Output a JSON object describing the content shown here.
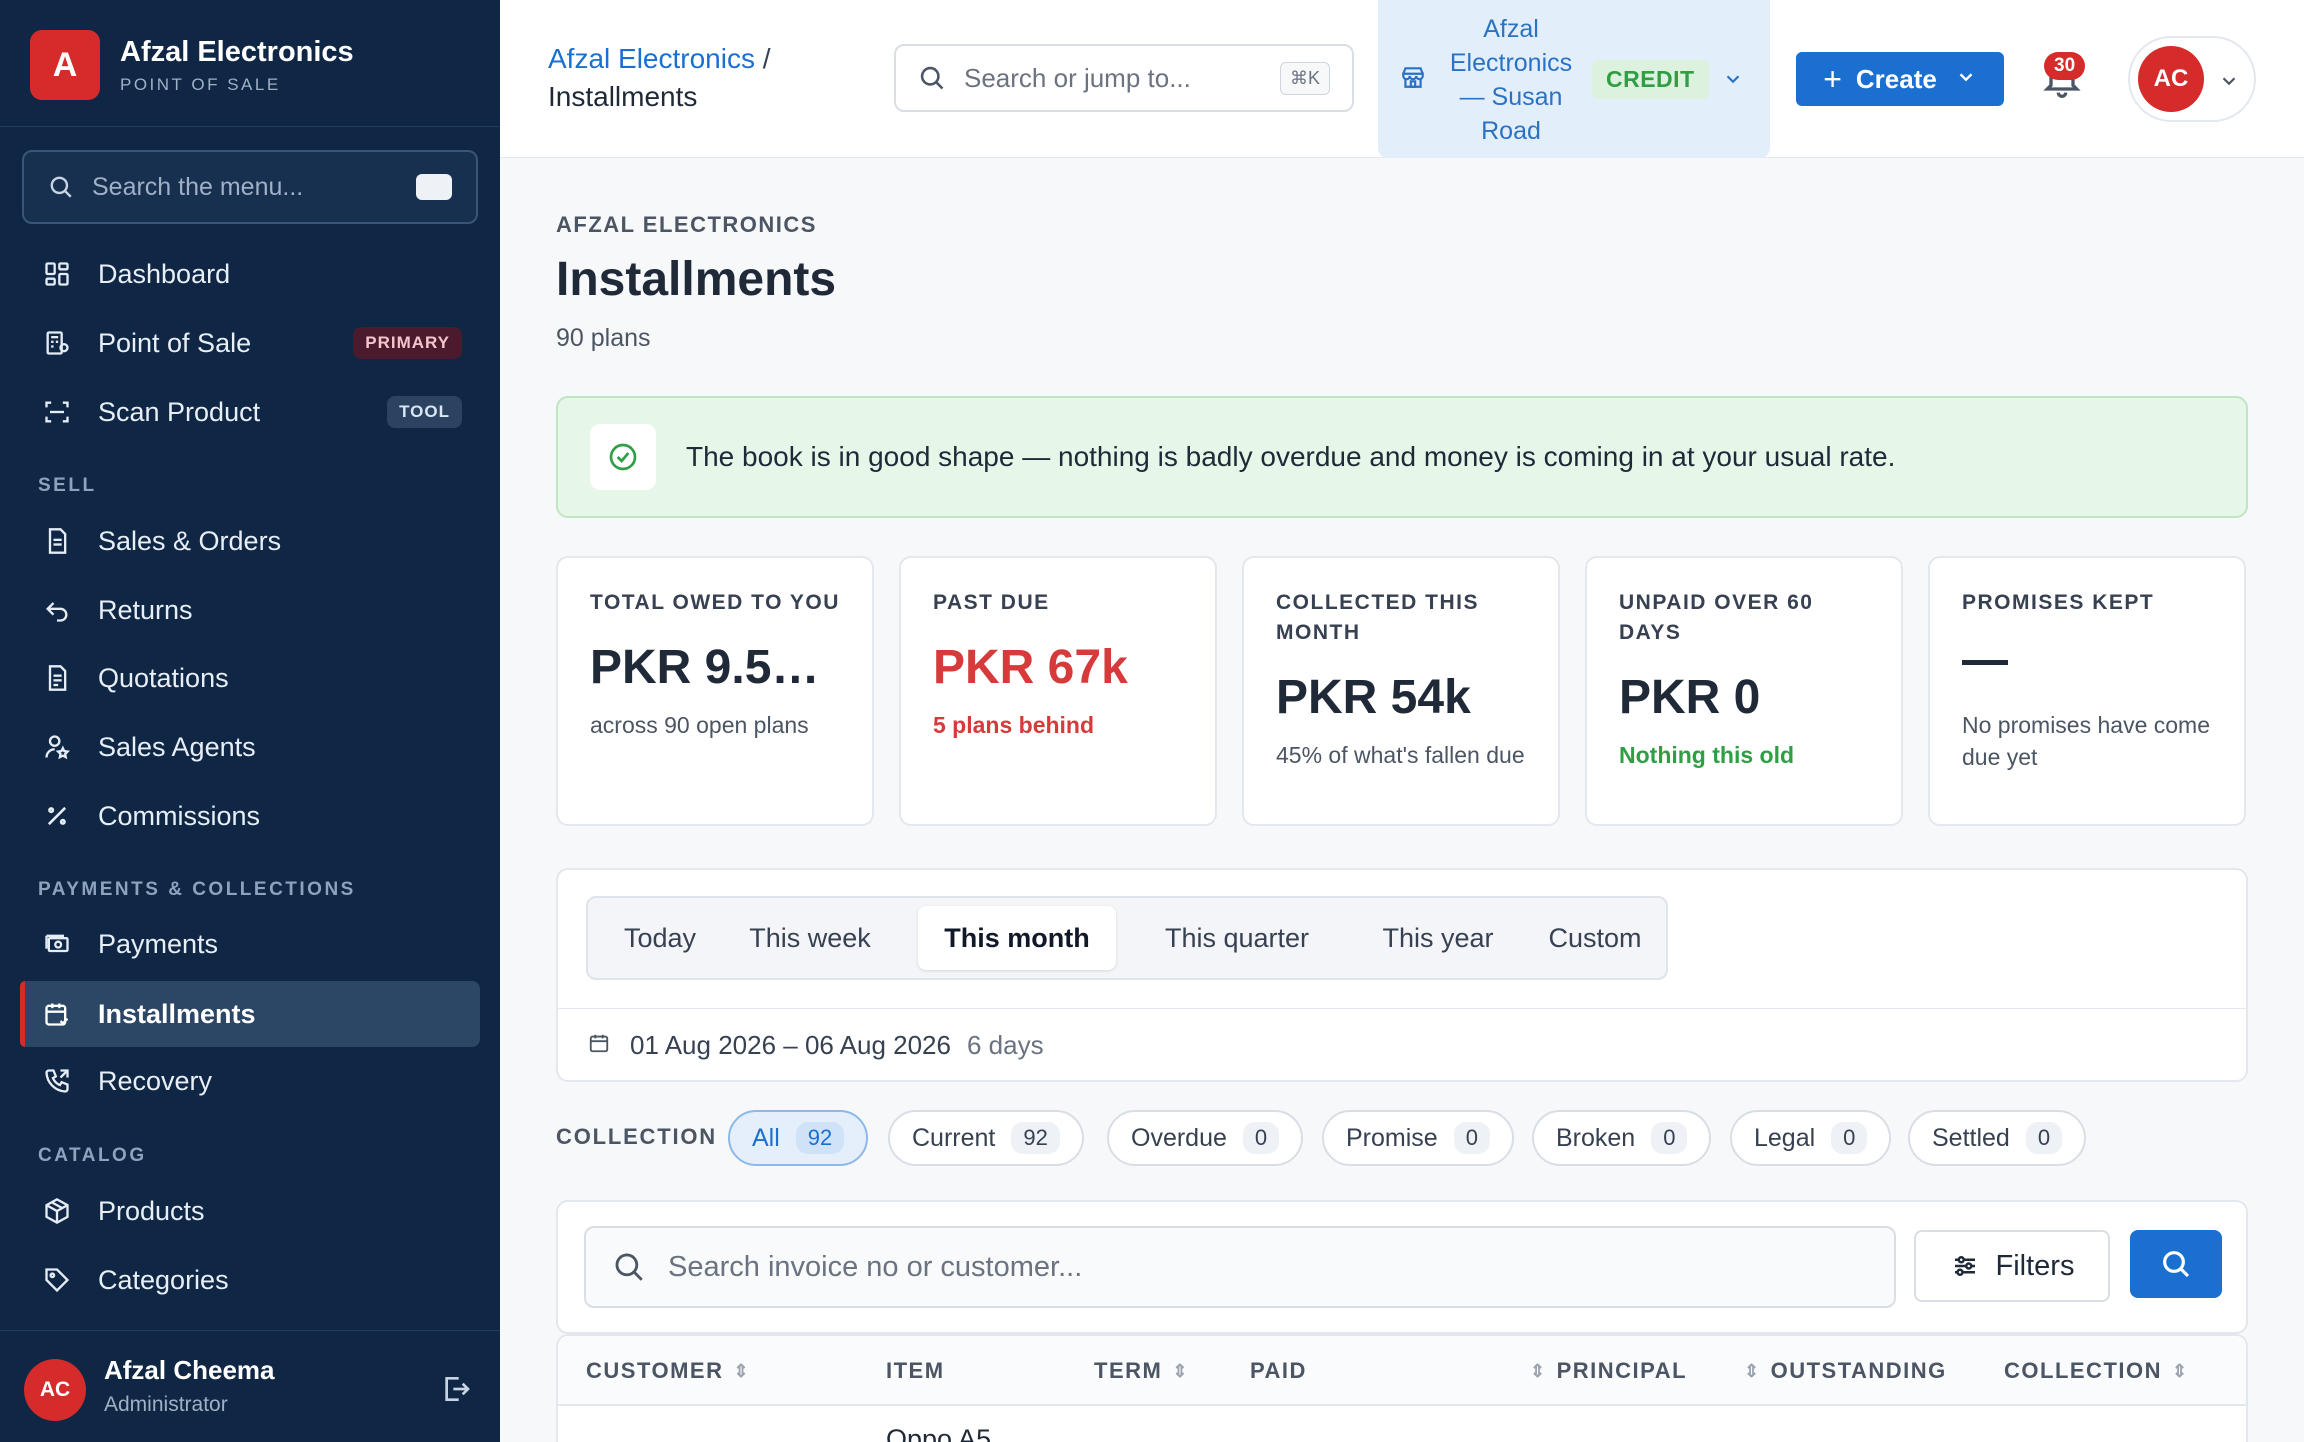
{
  "brand": {
    "logo_letter": "A",
    "name": "Afzal Electronics",
    "subtitle": "POINT OF SALE"
  },
  "sidebar": {
    "search_placeholder": "Search the menu...",
    "items": [
      {
        "label": "Dashboard",
        "icon": "dashboard-icon"
      },
      {
        "label": "Point of Sale",
        "icon": "register-icon",
        "badge": "PRIMARY"
      },
      {
        "label": "Scan Product",
        "icon": "scan-icon",
        "badge": "TOOL"
      },
      {
        "label": "Sales & Orders",
        "icon": "document-icon"
      },
      {
        "label": "Returns",
        "icon": "return-icon"
      },
      {
        "label": "Quotations",
        "icon": "quotation-icon"
      },
      {
        "label": "Sales Agents",
        "icon": "agent-icon"
      },
      {
        "label": "Commissions",
        "icon": "percent-icon"
      },
      {
        "label": "Payments",
        "icon": "cash-icon"
      },
      {
        "label": "Installments",
        "icon": "calendar-check-icon",
        "active": true
      },
      {
        "label": "Recovery",
        "icon": "phone-icon"
      },
      {
        "label": "Products",
        "icon": "box-icon"
      },
      {
        "label": "Categories",
        "icon": "tag-icon"
      }
    ],
    "sections": [
      "SELL",
      "PAYMENTS & COLLECTIONS",
      "CATALOG"
    ],
    "user": {
      "initials": "AC",
      "name": "Afzal Cheema",
      "role": "Administrator"
    }
  },
  "header": {
    "breadcrumb_parent": "Afzal Electronics",
    "breadcrumb_sep": "/",
    "breadcrumb_current": "Installments",
    "search_placeholder": "Search or jump to...",
    "search_shortcut": "⌘K",
    "store_name": "Afzal Electronics — Susan Road",
    "store_badge": "CREDIT",
    "create_label": "Create",
    "notifications_count": "30",
    "user_initials": "AC"
  },
  "page": {
    "eyebrow": "AFZAL ELECTRONICS",
    "title": "Installments",
    "subtitle": "90 plans",
    "banner": "The book is in good shape — nothing is badly overdue and money is coming in at your usual rate."
  },
  "stats": [
    {
      "label": "TOTAL OWED TO YOU",
      "value": "PKR 9.5…",
      "detail": "across 90 open plans"
    },
    {
      "label": "PAST DUE",
      "value": "PKR 67k",
      "detail": "5 plans behind"
    },
    {
      "label": "COLLECTED THIS MONTH",
      "value": "PKR 54k",
      "detail": "45% of what's fallen due"
    },
    {
      "label": "UNPAID OVER 60 DAYS",
      "value": "PKR 0",
      "detail": "Nothing this old"
    },
    {
      "label": "PROMISES KEPT",
      "value": "—",
      "detail": "No promises have come due yet"
    }
  ],
  "periods": {
    "options": [
      "Today",
      "This week",
      "This month",
      "This quarter",
      "This year",
      "Custom"
    ],
    "selected": "This month",
    "range": "01 Aug 2026 – 06 Aug 2026",
    "days": "6 days"
  },
  "collection": {
    "label": "COLLECTION",
    "chips": [
      {
        "label": "All",
        "count": "92",
        "selected": true
      },
      {
        "label": "Current",
        "count": "92"
      },
      {
        "label": "Overdue",
        "count": "0"
      },
      {
        "label": "Promise",
        "count": "0"
      },
      {
        "label": "Broken",
        "count": "0"
      },
      {
        "label": "Legal",
        "count": "0"
      },
      {
        "label": "Settled",
        "count": "0"
      }
    ]
  },
  "list": {
    "search_placeholder": "Search invoice no or customer...",
    "filters_label": "Filters",
    "columns": [
      "CUSTOMER",
      "ITEM",
      "TERM",
      "PAID",
      "PRINCIPAL",
      "OUTSTANDING",
      "COLLECTION"
    ],
    "first_row_item_peek": "Oppo A5"
  },
  "colors": {
    "sidebar_bg": "#0f2744",
    "accent": "#1b6fd1",
    "brand_red": "#d62b2b",
    "success": "#2f9e44",
    "danger": "#d63a3a"
  }
}
